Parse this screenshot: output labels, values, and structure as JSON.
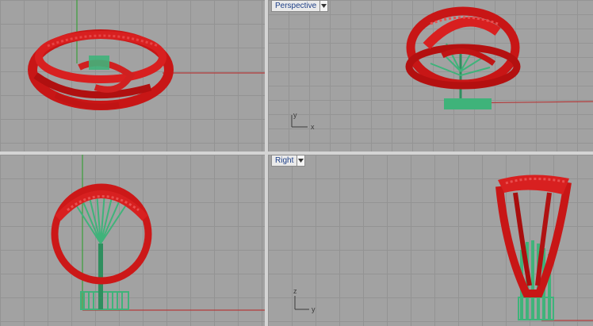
{
  "viewports": {
    "top": {
      "label": ""
    },
    "perspective": {
      "label": "Perspective",
      "menu_icon": "chevron-down-icon"
    },
    "front": {
      "label": ""
    },
    "right": {
      "label": "Right",
      "menu_icon": "chevron-down-icon"
    }
  },
  "axis_widget": {
    "perspective": {
      "x": "x",
      "y": "y"
    },
    "right": {
      "z": "z",
      "y": "y"
    }
  },
  "colors": {
    "ring_red": "#d01818",
    "support_green": "#3fb37a",
    "x_axis": "#b43c3c",
    "y_axis": "#3aa03a",
    "grid": "#939393",
    "background": "#a2a2a2"
  }
}
